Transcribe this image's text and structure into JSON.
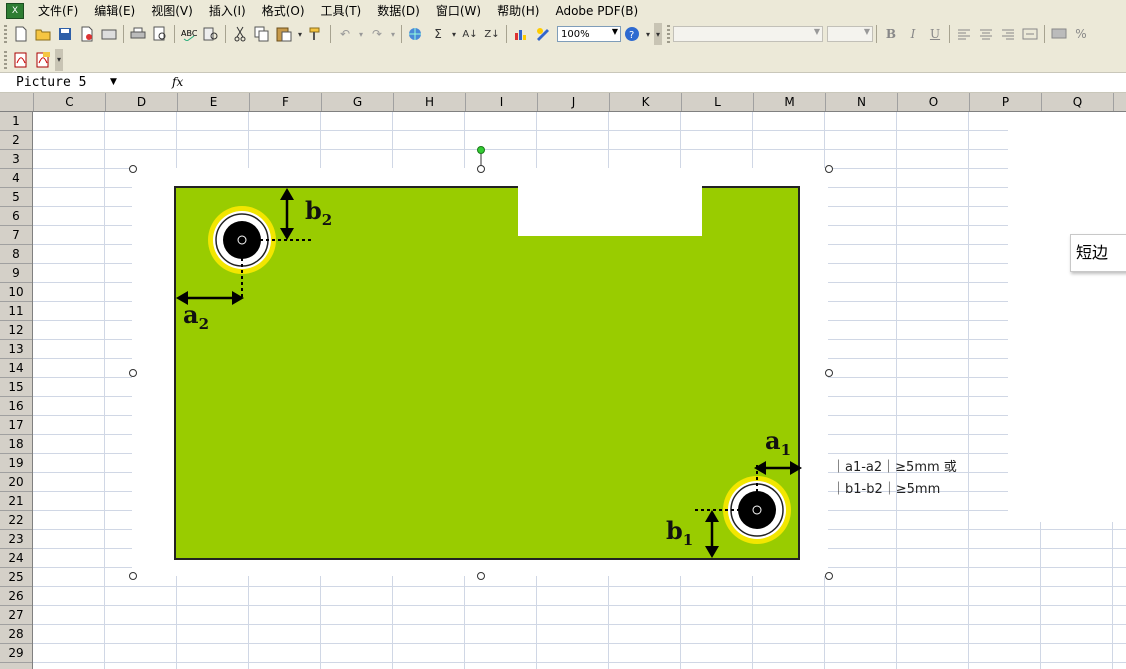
{
  "menu": {
    "items": [
      "文件(F)",
      "编辑(E)",
      "视图(V)",
      "插入(I)",
      "格式(O)",
      "工具(T)",
      "数据(D)",
      "窗口(W)",
      "帮助(H)",
      "Adobe PDF(B)"
    ]
  },
  "toolbar": {
    "zoom": "100%",
    "font_name": "",
    "font_size": "",
    "bold_label": "B",
    "italic_label": "I",
    "underline_label": "U",
    "percent_label": "%",
    "sum_label": "Σ"
  },
  "formula_bar": {
    "name_box": "Picture 5",
    "fx_label": "fx"
  },
  "columns": [
    "C",
    "D",
    "E",
    "F",
    "G",
    "H",
    "I",
    "J",
    "K",
    "L",
    "M",
    "N",
    "O",
    "P",
    "Q"
  ],
  "rows": [
    "1",
    "2",
    "3",
    "4",
    "5",
    "6",
    "7",
    "8",
    "9",
    "10",
    "11",
    "12",
    "13",
    "14",
    "15",
    "16",
    "17",
    "18",
    "19",
    "20",
    "21",
    "22",
    "23",
    "24",
    "25",
    "26",
    "27",
    "28",
    "29"
  ],
  "picture": {
    "label_b2": "b",
    "label_b2_sub": "2",
    "label_a2": "a",
    "label_a2_sub": "2",
    "label_a1": "a",
    "label_a1_sub": "1",
    "label_b1": "b",
    "label_b1_sub": "1",
    "colors": {
      "board": "#99cc00",
      "ring": "#f2e600",
      "hole": "#000000"
    }
  },
  "note": {
    "line1": "｜a1-a2｜≥5mm 或",
    "line2": "｜b1-b2｜≥5mm"
  },
  "popup": {
    "text": "短边"
  }
}
